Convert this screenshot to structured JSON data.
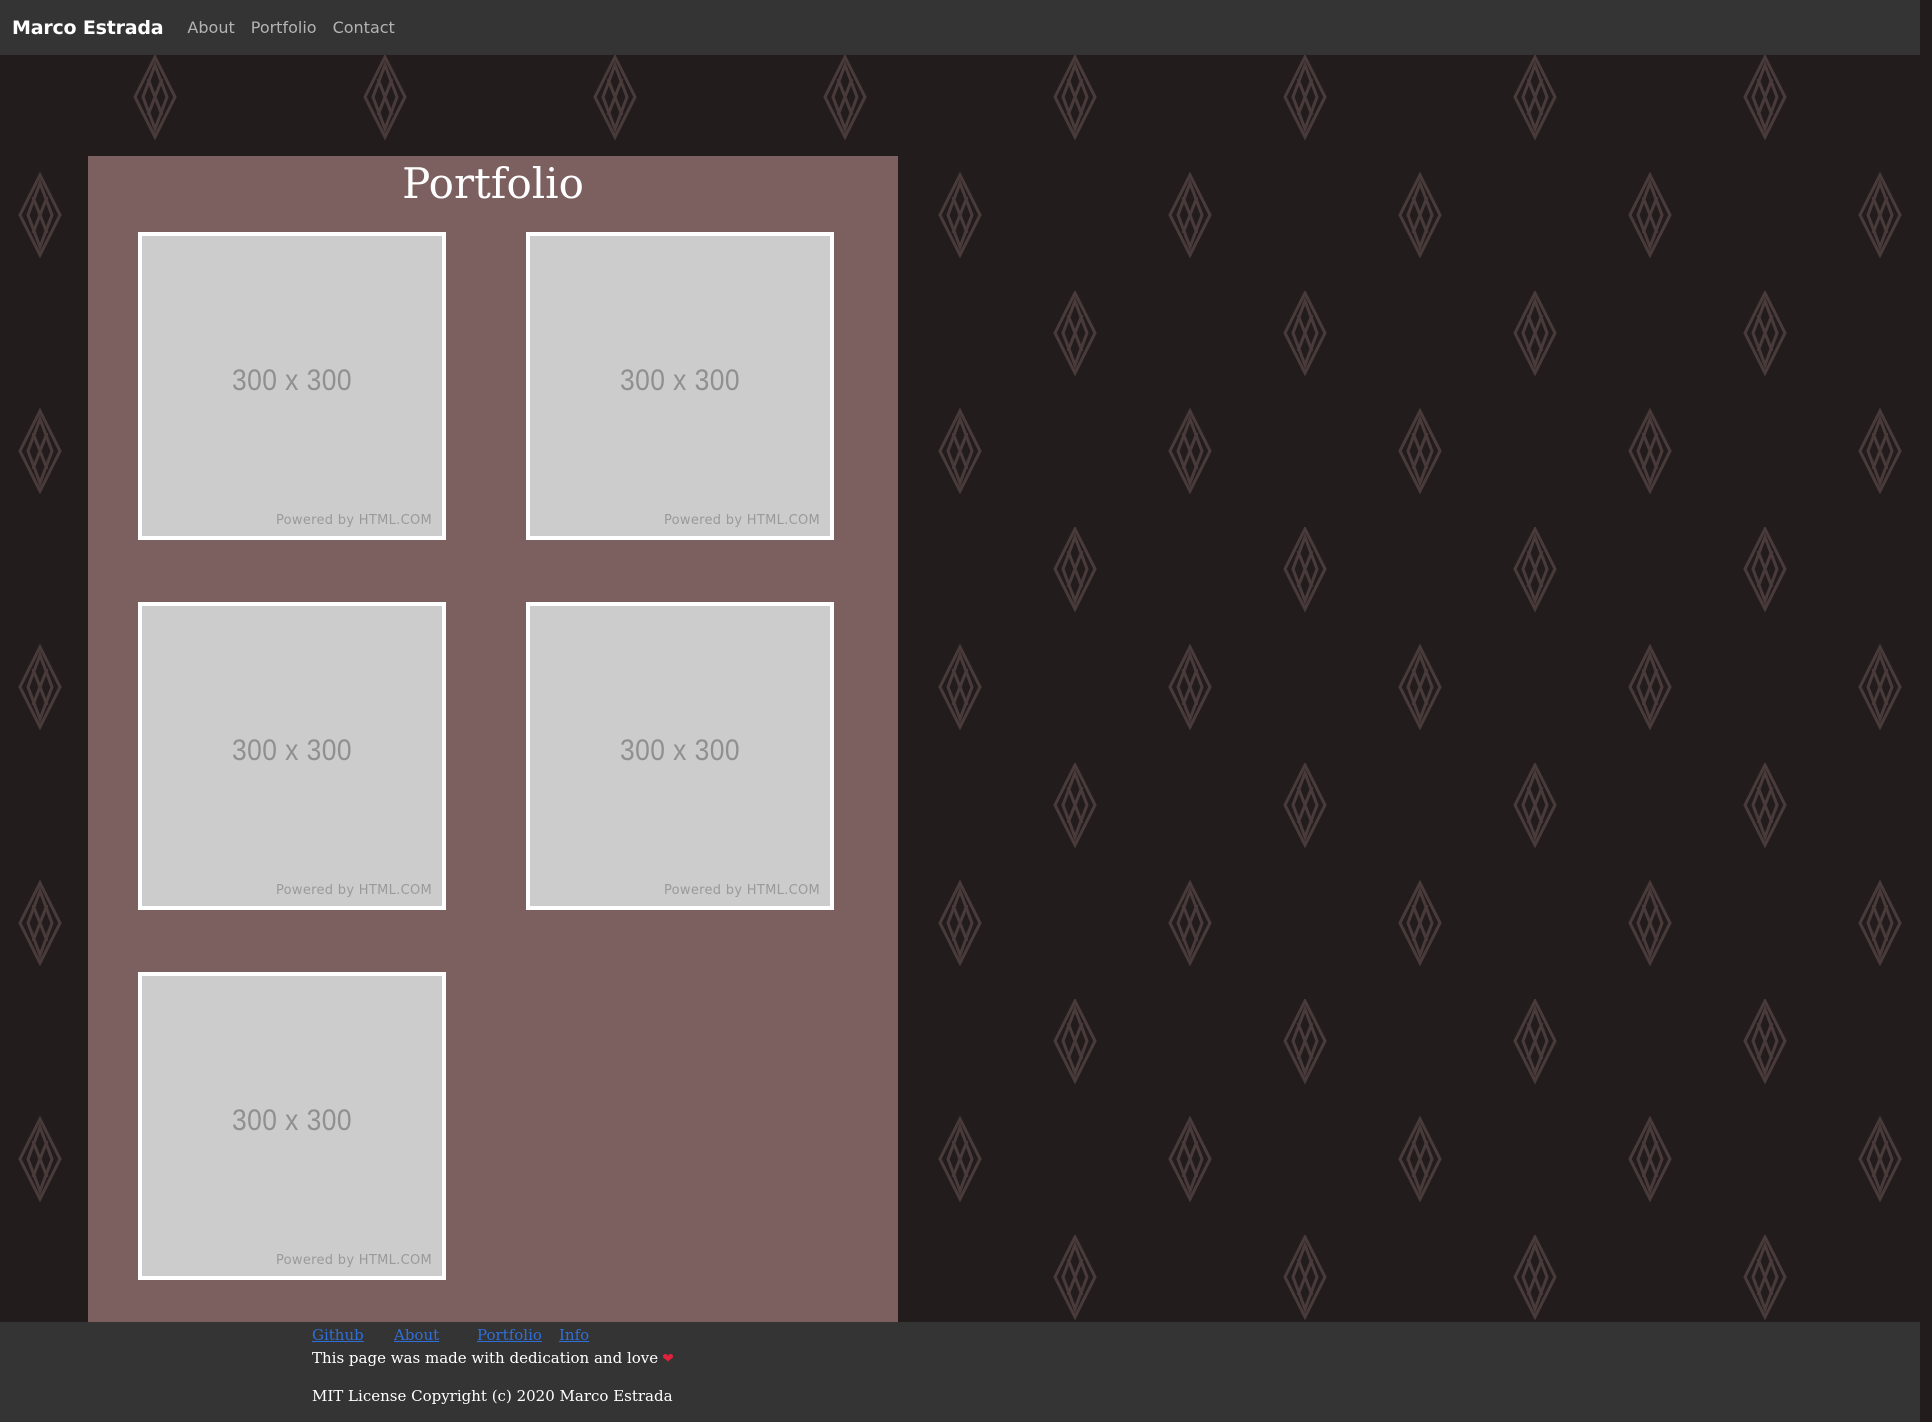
{
  "navbar": {
    "brand": "Marco Estrada",
    "links": [
      "About",
      "Portfolio",
      "Contact"
    ]
  },
  "main": {
    "title": "Portfolio",
    "thumbnails": [
      {
        "size_label": "300 x 300",
        "powered_label": "Powered by HTML.COM"
      },
      {
        "size_label": "300 x 300",
        "powered_label": "Powered by HTML.COM"
      },
      {
        "size_label": "300 x 300",
        "powered_label": "Powered by HTML.COM"
      },
      {
        "size_label": "300 x 300",
        "powered_label": "Powered by HTML.COM"
      },
      {
        "size_label": "300 x 300",
        "powered_label": "Powered by HTML.COM"
      }
    ]
  },
  "footer": {
    "links": [
      "Github",
      "About",
      "Portfolio",
      "Info"
    ],
    "tagline": "This page was made with dedication and love",
    "heart_icon": "heart-icon",
    "copyright": "MIT License Copyright (c) 2020 Marco Estrada"
  },
  "colors": {
    "background": "#231c1d",
    "pattern": "#4a3b3b",
    "navbar": "#343434",
    "panel": "#7c5f5f",
    "link": "#2f6fd8",
    "heart": "#e0223b"
  }
}
